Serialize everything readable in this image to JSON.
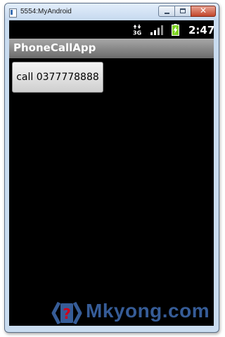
{
  "window": {
    "title": "5554:MyAndroid"
  },
  "status_bar": {
    "network_label": "3G",
    "time": "2:47"
  },
  "app_bar": {
    "title": "PhoneCallApp"
  },
  "main": {
    "call_button_label": "call 0377778888"
  },
  "watermark": {
    "text": "Mkyong.com"
  },
  "colors": {
    "screen_background": "#000000",
    "app_bar": "#8c8c8c",
    "battery": "#7ed321",
    "watermark": "#3f6cb2"
  }
}
